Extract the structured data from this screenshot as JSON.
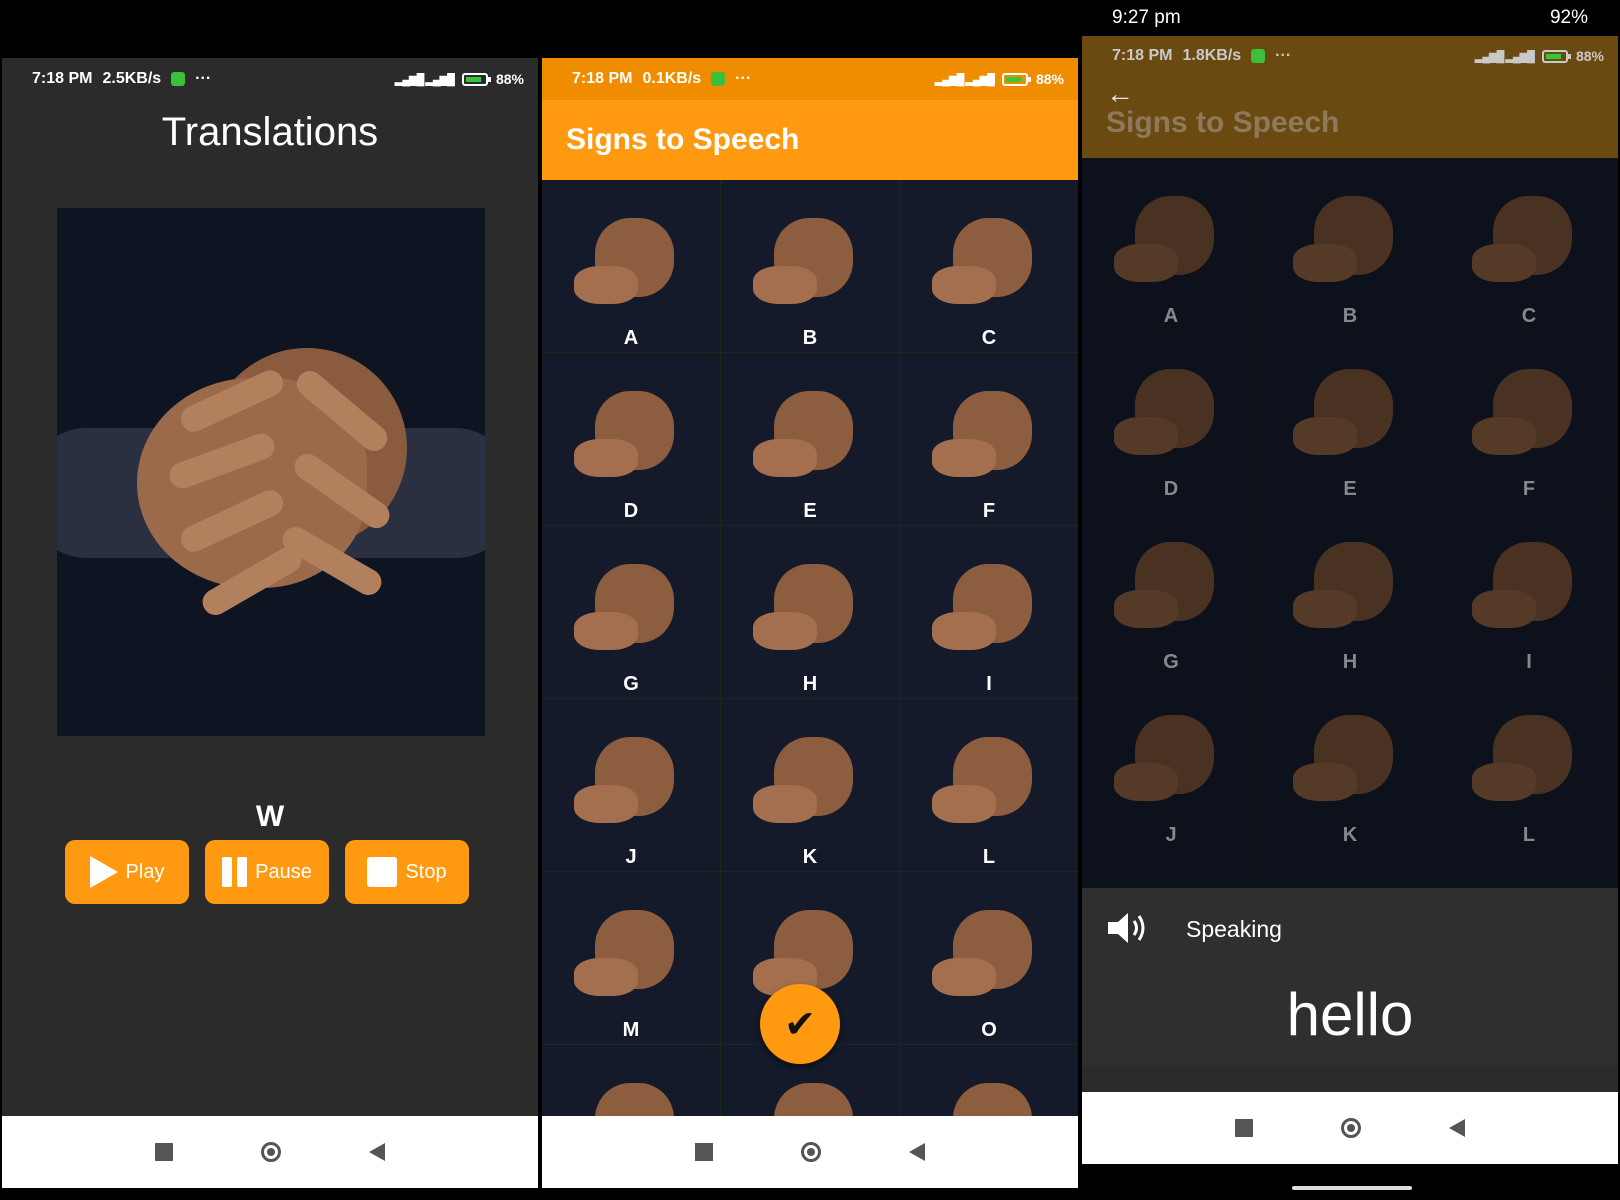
{
  "phone1": {
    "status": {
      "time": "7:18 PM",
      "speed": "2.5KB/s",
      "more": "···",
      "battery": "88%"
    },
    "title": "Translations",
    "letter": "W",
    "buttons": [
      {
        "label": "Play",
        "icon": "play-icon"
      },
      {
        "label": "Pause",
        "icon": "pause-icon"
      },
      {
        "label": "Stop",
        "icon": "stop-icon"
      }
    ],
    "accent": "#ff9a10"
  },
  "phone2": {
    "status": {
      "time": "7:18 PM",
      "speed": "0.1KB/s",
      "more": "···",
      "battery": "88%"
    },
    "title": "Signs to Speech",
    "letters": [
      "A",
      "B",
      "C",
      "D",
      "E",
      "F",
      "G",
      "H",
      "I",
      "J",
      "K",
      "L",
      "M",
      "",
      "O",
      "",
      "",
      ""
    ],
    "fab_icon": "check-icon",
    "accent": "#ff9a10"
  },
  "phone3": {
    "device_status": {
      "time": "9:27 pm",
      "battery": "92%"
    },
    "status": {
      "time": "7:18 PM",
      "speed": "1.8KB/s",
      "more": "···",
      "battery": "88%"
    },
    "title": "Signs to Speech",
    "letters": [
      "A",
      "B",
      "C",
      "D",
      "E",
      "F",
      "G",
      "H",
      "I",
      "J",
      "K",
      "L",
      "",
      "",
      ""
    ],
    "speaking_label": "Speaking",
    "spoken_text": "hello",
    "speaker_icon": "speaker-icon"
  }
}
